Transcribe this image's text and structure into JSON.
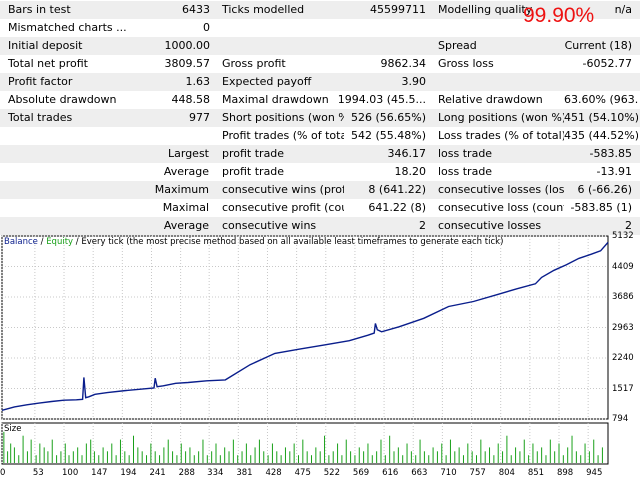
{
  "report": {
    "rows": [
      {
        "c1": "Bars in test",
        "c2": "6433",
        "c3": "Ticks modelled",
        "c4": "45599711",
        "c5": "Modelling quality",
        "c6": "n/a"
      },
      {
        "c1": "Mismatched charts ...",
        "c2": "0"
      },
      {
        "c1": "Initial deposit",
        "c2": "1000.00",
        "c5": "Spread",
        "c6": "Current (18)"
      },
      {
        "c1": "Total net profit",
        "c2": "3809.57",
        "c3": "Gross profit",
        "c4": "9862.34",
        "c5": "Gross loss",
        "c6": "-6052.77"
      },
      {
        "c1": "Profit factor",
        "c2": "1.63",
        "c3": "Expected payoff",
        "c4": "3.90"
      },
      {
        "c1": "Absolute drawdown",
        "c2": "448.58",
        "c3": "Maximal drawdown",
        "c4": "1994.03 (45.5...",
        "c5": "Relative drawdown",
        "c6": "63.60% (963...."
      },
      {
        "c1": "Total trades",
        "c2": "977",
        "c3": "Short positions (won %)",
        "c4": "526 (56.65%)",
        "c5": "Long positions (won %)",
        "c6": "451 (54.10%)"
      },
      {
        "c3": "Profit trades (% of total)",
        "c4": "542 (55.48%)",
        "c5": "Loss trades (% of total)",
        "c6": "435 (44.52%)"
      },
      {
        "r1": "Largest",
        "c3": "profit trade",
        "c4": "346.17",
        "c5": "loss trade",
        "c6": "-583.85"
      },
      {
        "r1": "Average",
        "c3": "profit trade",
        "c4": "18.20",
        "c5": "loss trade",
        "c6": "-13.91"
      },
      {
        "r1": "Maximum",
        "c3": "consecutive wins (profit...",
        "c4": "8 (641.22)",
        "c5": "consecutive losses (loss...",
        "c6": "6 (-66.26)"
      },
      {
        "r1": "Maximal",
        "c3": "consecutive profit (cou...",
        "c4": "641.22 (8)",
        "c5": "consecutive loss (count...",
        "c6": "-583.85 (1)"
      },
      {
        "r1": "Average",
        "c3": "consecutive wins",
        "c4": "2",
        "c5": "consecutive losses",
        "c6": "2"
      }
    ],
    "modelling_quality_overlay": "99.90%",
    "ticks_bar_fill_fraction": 0.92
  },
  "chart": {
    "legend": {
      "balance": "Balance",
      "sep1": " / ",
      "equity": "Equity",
      "sep2": " / ",
      "description": "Every tick (the most precise method based on all available least timeframes to generate each tick)"
    },
    "size_label": "Size",
    "colors": {
      "balance": "#0a1e8c",
      "equity": "#18a018",
      "volume": "#19a019",
      "grid": "#c8c8c8",
      "overlay": "#ee1111",
      "bar_fill": "#11ee11"
    }
  },
  "chart_data": {
    "type": "line",
    "xlabel": "",
    "ylabel": "",
    "x_ticks": [
      "0",
      "53",
      "100",
      "147",
      "194",
      "241",
      "288",
      "334",
      "381",
      "428",
      "475",
      "522",
      "569",
      "616",
      "663",
      "710",
      "757",
      "804",
      "851",
      "898",
      "945"
    ],
    "y_ticks": [
      "5132",
      "4409",
      "3686",
      "2963",
      "2240",
      "1517",
      "794"
    ],
    "xlim": [
      0,
      977
    ],
    "ylim": [
      794,
      5132
    ],
    "grid": true,
    "series": [
      {
        "name": "Balance",
        "x": [
          0,
          20,
          40,
          60,
          80,
          100,
          120,
          130,
          132,
          135,
          140,
          150,
          170,
          200,
          230,
          245,
          247,
          250,
          260,
          280,
          300,
          330,
          360,
          400,
          440,
          480,
          520,
          560,
          590,
          600,
          602,
          605,
          612,
          640,
          680,
          720,
          760,
          800,
          830,
          860,
          870,
          890,
          910,
          930,
          950,
          965,
          977
        ],
        "values": [
          1000,
          1080,
          1130,
          1170,
          1210,
          1240,
          1250,
          1260,
          1780,
          1300,
          1320,
          1380,
          1420,
          1470,
          1510,
          1530,
          1760,
          1560,
          1580,
          1640,
          1660,
          1700,
          1720,
          2080,
          2350,
          2450,
          2550,
          2650,
          2780,
          2830,
          3060,
          2910,
          2860,
          2980,
          3180,
          3460,
          3580,
          3750,
          3880,
          4000,
          4150,
          4320,
          4450,
          4600,
          4700,
          4780,
          4980
        ]
      }
    ],
    "volume": {
      "name": "Size",
      "x": [
        3,
        9,
        14,
        20,
        27,
        34,
        41,
        47,
        55,
        61,
        68,
        74,
        81,
        88,
        95,
        102,
        108,
        115,
        122,
        129,
        136,
        143,
        149,
        156,
        163,
        170,
        177,
        184,
        191,
        198,
        205,
        212,
        219,
        226,
        233,
        240,
        247,
        254,
        261,
        268,
        275,
        282,
        289,
        296,
        303,
        310,
        317,
        324,
        331,
        338,
        345,
        352,
        359,
        366,
        373,
        380,
        387,
        394,
        401,
        408,
        415,
        422,
        429,
        436,
        443,
        450,
        457,
        464,
        471,
        478,
        485,
        492,
        499,
        506,
        513,
        520,
        527,
        534,
        541,
        548,
        555,
        562,
        569,
        576,
        583,
        590,
        597,
        604,
        611,
        618,
        625,
        632,
        639,
        646,
        653,
        660,
        667,
        674,
        681,
        688,
        695,
        702,
        709,
        716,
        723,
        730,
        737,
        744,
        751,
        758,
        765,
        772,
        779,
        786,
        793,
        800,
        807,
        814,
        821,
        828,
        835,
        842,
        849,
        856,
        863,
        870,
        877,
        884,
        891,
        898,
        905,
        912,
        919,
        926,
        933,
        940,
        947,
        954,
        961,
        968
      ],
      "values": [
        0.8,
        0.3,
        0.5,
        0.4,
        0.2,
        0.7,
        0.3,
        0.6,
        0.2,
        0.5,
        0.4,
        0.3,
        0.6,
        0.2,
        0.3,
        0.5,
        0.2,
        0.3,
        0.4,
        0.2,
        0.5,
        0.6,
        0.3,
        0.2,
        0.4,
        0.3,
        0.5,
        0.2,
        0.6,
        0.3,
        0.2,
        0.7,
        0.4,
        0.3,
        0.2,
        0.5,
        0.3,
        0.2,
        0.4,
        0.6,
        0.3,
        0.2,
        0.5,
        0.3,
        0.4,
        0.2,
        0.3,
        0.6,
        0.2,
        0.3,
        0.5,
        0.2,
        0.4,
        0.3,
        0.6,
        0.2,
        0.3,
        0.5,
        0.2,
        0.4,
        0.6,
        0.3,
        0.2,
        0.5,
        0.3,
        0.2,
        0.4,
        0.3,
        0.5,
        0.2,
        0.6,
        0.3,
        0.2,
        0.4,
        0.3,
        0.7,
        0.2,
        0.3,
        0.5,
        0.2,
        0.6,
        0.3,
        0.2,
        0.4,
        0.3,
        0.5,
        0.2,
        0.3,
        0.6,
        0.2,
        0.7,
        0.3,
        0.4,
        0.2,
        0.5,
        0.3,
        0.2,
        0.6,
        0.3,
        0.2,
        0.4,
        0.3,
        0.5,
        0.2,
        0.6,
        0.3,
        0.4,
        0.2,
        0.5,
        0.3,
        0.2,
        0.6,
        0.3,
        0.4,
        0.2,
        0.5,
        0.3,
        0.7,
        0.2,
        0.4,
        0.3,
        0.6,
        0.2,
        0.5,
        0.3,
        0.4,
        0.2,
        0.6,
        0.3,
        0.5,
        0.2,
        0.4,
        0.7,
        0.3,
        0.2,
        0.5,
        0.3,
        0.6,
        0.2,
        0.4
      ]
    }
  }
}
